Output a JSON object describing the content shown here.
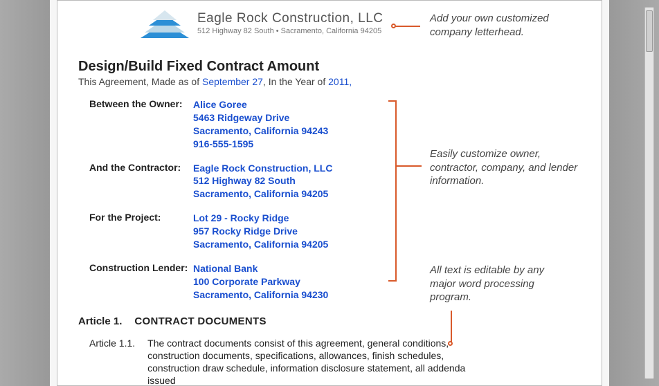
{
  "letterhead": {
    "company_name": "Eagle Rock Construction, LLC",
    "address": "512 Highway 82 South • Sacramento, California 94205"
  },
  "doc": {
    "title": "Design/Build Fixed Contract Amount",
    "agreement_prefix": "This Agreement, Made as of ",
    "agreement_date": "September 27",
    "agreement_mid": ", In the Year of ",
    "agreement_year": "2011,"
  },
  "parties": {
    "owner_label": "Between the Owner:",
    "owner_value": "Alice Goree\n5463 Ridgeway Drive\nSacramento, California 94243\n916-555-1595",
    "contractor_label": "And the Contractor:",
    "contractor_value": "Eagle Rock Construction, LLC\n512 Highway 82 South\nSacramento, California 94205",
    "project_label": "For the Project:",
    "project_value": "Lot 29 - Rocky Ridge\n957 Rocky Ridge Drive\nSacramento, California 94205",
    "lender_label": "Construction Lender:",
    "lender_value": "National Bank\n100 Corporate Parkway\nSacramento, California 94230"
  },
  "article": {
    "num": "Article 1.",
    "title": "CONTRACT DOCUMENTS",
    "sub_num": "Article 1.1.",
    "sub_text": "The contract documents consist of this agreement, general conditions, construction documents, specifications, allowances, finish schedules, construction draw schedule, information disclosure statement, all addenda issued"
  },
  "callouts": {
    "c1": "Add your own customized company letterhead.",
    "c2": "Easily customize owner, contractor, company, and lender information.",
    "c3": "All text is editable by any major word processing program."
  }
}
